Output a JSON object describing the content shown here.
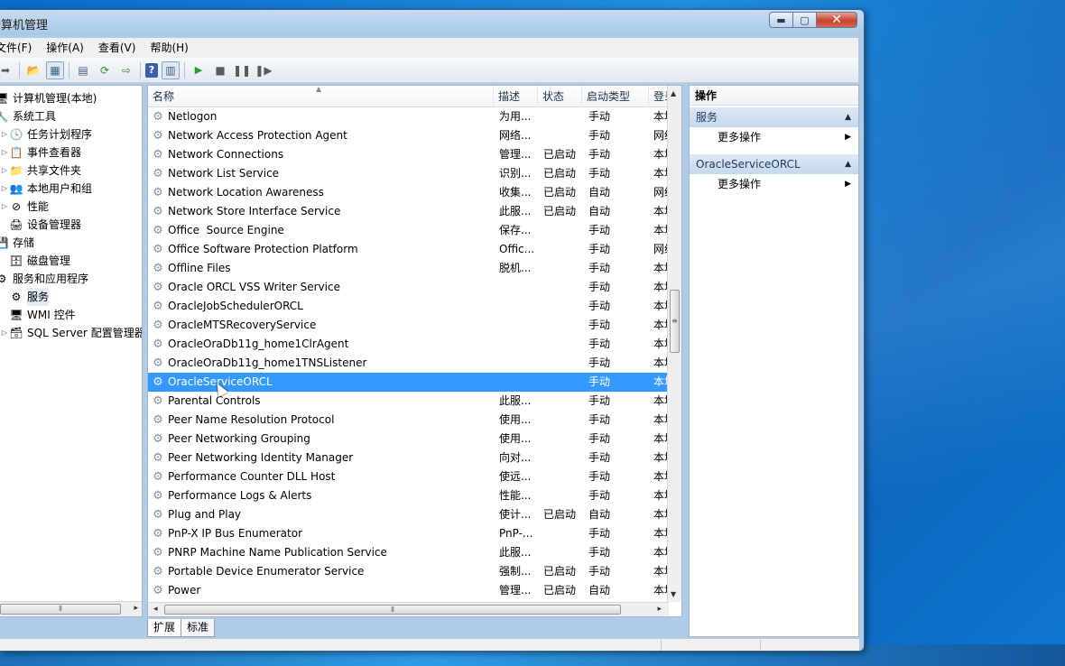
{
  "window": {
    "title": "计算机管理",
    "controls": {
      "minimize": "▬",
      "maximize": "▢",
      "close": "✕"
    }
  },
  "menu": [
    "文件(F)",
    "操作(A)",
    "查看(V)",
    "帮助(H)"
  ],
  "tree": {
    "items": [
      {
        "label": "计算机管理(本地)",
        "icon": "computer-icon",
        "glyph": "🖥",
        "expander": "",
        "indent": 0
      },
      {
        "label": "系统工具",
        "icon": "tools-icon",
        "glyph": "🔧",
        "expander": "",
        "indent": 0
      },
      {
        "label": "任务计划程序",
        "icon": "clock-icon",
        "glyph": "🕓",
        "expander": "▷",
        "indent": 1
      },
      {
        "label": "事件查看器",
        "icon": "event-viewer-icon",
        "glyph": "📋",
        "expander": "▷",
        "indent": 1
      },
      {
        "label": "共享文件夹",
        "icon": "shared-folder-icon",
        "glyph": "📁",
        "expander": "▷",
        "indent": 1
      },
      {
        "label": "本地用户和组",
        "icon": "users-icon",
        "glyph": "👥",
        "expander": "▷",
        "indent": 1
      },
      {
        "label": "性能",
        "icon": "performance-icon",
        "glyph": "⊘",
        "expander": "▷",
        "indent": 1
      },
      {
        "label": "设备管理器",
        "icon": "device-manager-icon",
        "glyph": "🖨",
        "expander": "",
        "indent": 1
      },
      {
        "label": "存储",
        "icon": "storage-icon",
        "glyph": "💾",
        "expander": "",
        "indent": 0
      },
      {
        "label": "磁盘管理",
        "icon": "disk-icon",
        "glyph": "🗄",
        "expander": "",
        "indent": 1
      },
      {
        "label": "服务和应用程序",
        "icon": "services-apps-icon",
        "glyph": "⚙",
        "expander": "",
        "indent": 0
      },
      {
        "label": "服务",
        "icon": "services-icon",
        "glyph": "⚙",
        "expander": "",
        "indent": 1,
        "selected": true
      },
      {
        "label": "WMI 控件",
        "icon": "wmi-icon",
        "glyph": "🖥",
        "expander": "",
        "indent": 1
      },
      {
        "label": "SQL Server 配置管理器",
        "icon": "sql-server-icon",
        "glyph": "🗃",
        "expander": "▷",
        "indent": 1
      }
    ],
    "hscroll_thumb": "⦀"
  },
  "list": {
    "columns": {
      "name": "名称",
      "desc": "描述",
      "status": "状态",
      "start": "启动类型",
      "logon": "登录"
    },
    "sort_caret": "▲",
    "rows": [
      {
        "name": "Netlogon",
        "desc": "为用...",
        "status": "",
        "start": "手动",
        "logon": "本地"
      },
      {
        "name": "Network Access Protection Agent",
        "desc": "网络...",
        "status": "",
        "start": "手动",
        "logon": "网络"
      },
      {
        "name": "Network Connections",
        "desc": "管理...",
        "status": "已启动",
        "start": "手动",
        "logon": "本地"
      },
      {
        "name": "Network List Service",
        "desc": "识别...",
        "status": "已启动",
        "start": "手动",
        "logon": "本地"
      },
      {
        "name": "Network Location Awareness",
        "desc": "收集...",
        "status": "已启动",
        "start": "自动",
        "logon": "网络"
      },
      {
        "name": "Network Store Interface Service",
        "desc": "此服...",
        "status": "已启动",
        "start": "自动",
        "logon": "本地"
      },
      {
        "name": "Office  Source Engine",
        "desc": "保存...",
        "status": "",
        "start": "手动",
        "logon": "本地"
      },
      {
        "name": "Office Software Protection Platform",
        "desc": "Offic...",
        "status": "",
        "start": "手动",
        "logon": "网络"
      },
      {
        "name": "Offline Files",
        "desc": "脱机...",
        "status": "",
        "start": "手动",
        "logon": "本地"
      },
      {
        "name": "Oracle ORCL VSS Writer Service",
        "desc": "",
        "status": "",
        "start": "手动",
        "logon": "本地"
      },
      {
        "name": "OracleJobSchedulerORCL",
        "desc": "",
        "status": "",
        "start": "手动",
        "logon": "本地"
      },
      {
        "name": "OracleMTSRecoveryService",
        "desc": "",
        "status": "",
        "start": "手动",
        "logon": "本地"
      },
      {
        "name": "OracleOraDb11g_home1ClrAgent",
        "desc": "",
        "status": "",
        "start": "手动",
        "logon": "本地"
      },
      {
        "name": "OracleOraDb11g_home1TNSListener",
        "desc": "",
        "status": "",
        "start": "手动",
        "logon": "本地"
      },
      {
        "name": "OracleServiceORCL",
        "desc": "",
        "status": "",
        "start": "手动",
        "logon": "本地",
        "selected": true
      },
      {
        "name": "Parental Controls",
        "desc": "此服...",
        "status": "",
        "start": "手动",
        "logon": "本地"
      },
      {
        "name": "Peer Name Resolution Protocol",
        "desc": "使用...",
        "status": "",
        "start": "手动",
        "logon": "本地"
      },
      {
        "name": "Peer Networking Grouping",
        "desc": "使用...",
        "status": "",
        "start": "手动",
        "logon": "本地"
      },
      {
        "name": "Peer Networking Identity Manager",
        "desc": "向对...",
        "status": "",
        "start": "手动",
        "logon": "本地"
      },
      {
        "name": "Performance Counter DLL Host",
        "desc": "使远...",
        "status": "",
        "start": "手动",
        "logon": "本地"
      },
      {
        "name": "Performance Logs & Alerts",
        "desc": "性能...",
        "status": "",
        "start": "手动",
        "logon": "本地"
      },
      {
        "name": "Plug and Play",
        "desc": "使计...",
        "status": "已启动",
        "start": "自动",
        "logon": "本地"
      },
      {
        "name": "PnP-X IP Bus Enumerator",
        "desc": "PnP-...",
        "status": "",
        "start": "手动",
        "logon": "本地"
      },
      {
        "name": "PNRP Machine Name Publication Service",
        "desc": "此服...",
        "status": "",
        "start": "手动",
        "logon": "本地"
      },
      {
        "name": "Portable Device Enumerator Service",
        "desc": "强制...",
        "status": "已启动",
        "start": "手动",
        "logon": "本地"
      },
      {
        "name": "Power",
        "desc": "管理...",
        "status": "已启动",
        "start": "自动",
        "logon": "本地"
      }
    ],
    "scroll_grip": "≡",
    "hscroll_grip": "⦀"
  },
  "tabs": [
    "扩展",
    "标准"
  ],
  "actions": {
    "title": "操作",
    "sections": [
      {
        "label": "服务",
        "more": "更多操作"
      },
      {
        "label": "OracleServiceORCL",
        "more": "更多操作"
      }
    ]
  },
  "colors": {
    "selection": "#3399ff",
    "section_header": "#c5d8ee"
  }
}
